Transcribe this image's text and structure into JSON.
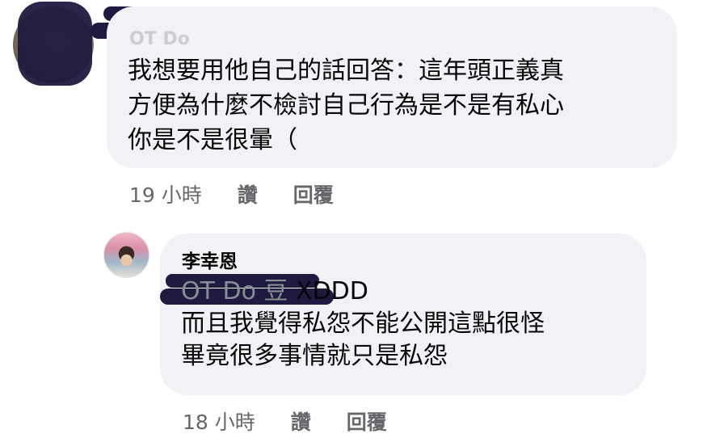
{
  "comment": {
    "author": "OT Do",
    "lines": [
      "我想要用他自己的話回答：這年頭正義真",
      "方便為什麼不檢討自己行為是不是有私心",
      "你是不是很暈（"
    ],
    "time": "19 小時",
    "like_label": "讚",
    "reply_label": "回覆"
  },
  "reply": {
    "author": "李幸恩",
    "mention": "OT Do 豆",
    "mention_suffix": " XDDD",
    "lines": [
      "而且我覺得私怨不能公開這點很怪",
      "畢竟很多事情就只是私怨"
    ],
    "time": "18 小時",
    "like_label": "讚",
    "reply_label": "回覆"
  }
}
